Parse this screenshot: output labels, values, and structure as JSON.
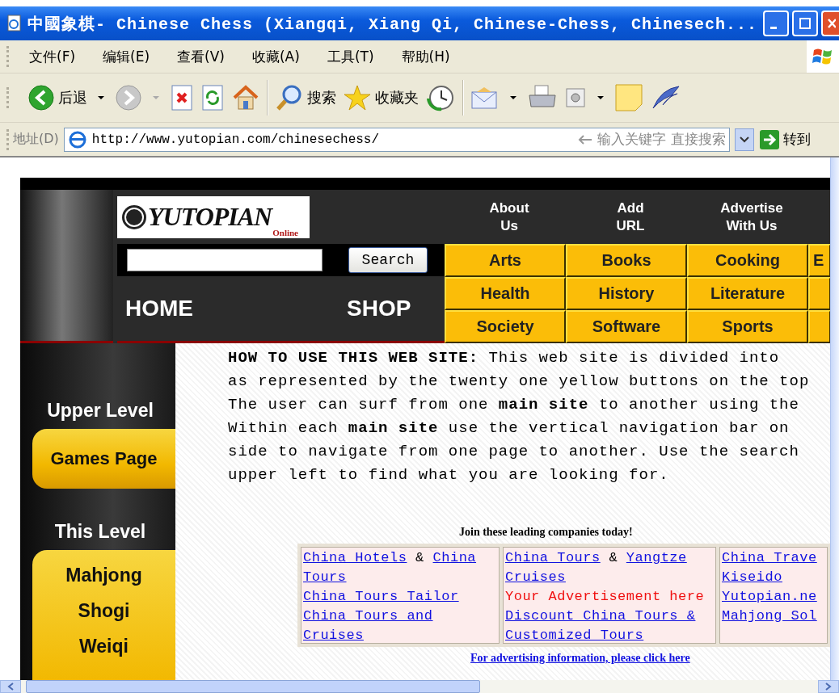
{
  "window": {
    "title": "中國象棋- Chinese Chess (Xiangqi, Xiang Qi, Chinese-Chess, Chinesech..."
  },
  "menu_bar": {
    "items": [
      "文件(F)",
      "编辑(E)",
      "查看(V)",
      "收藏(A)",
      "工具(T)",
      "帮助(H)"
    ]
  },
  "toolbar": {
    "back_label": "后退",
    "search_label": "搜索",
    "favorites_label": "收藏夹"
  },
  "address_bar": {
    "label": "地址(D)",
    "url": "http://www.yutopian.com/chinesechess/",
    "search_hint": "输入关键字 直接搜索",
    "go_label": "转到"
  },
  "site": {
    "logo": {
      "name": "YUTOPIAN",
      "tagline": "Online"
    },
    "top_links": [
      "About\nUs",
      "Add\nURL",
      "Advertise\nWith Us"
    ],
    "search": {
      "button": "Search"
    },
    "home_link": "HOME",
    "shop_link": "SHOP",
    "category_rows": [
      [
        "Arts",
        "Books",
        "Cooking",
        "E"
      ],
      [
        "Health",
        "History",
        "Literature"
      ],
      [
        "Society",
        "Software",
        "Sports"
      ]
    ],
    "sidebar": {
      "upper_heading": "Upper Level",
      "upper_items": [
        "Games Page"
      ],
      "this_heading": "This Level",
      "this_items": [
        "Mahjong",
        "Shogi",
        "Weiqi"
      ]
    },
    "intro": "**HOW TO USE THIS WEB SITE:** This web site is divided into\nas represented by the twenty one yellow buttons on the top\nThe user can surf from one **main site** to another using the\nWithin each **main site** use the vertical navigation bar on\nside to navigate from one page to another. Use the search\nupper left to find what you are looking for.",
    "ads": {
      "title": "Join these leading companies today!",
      "columns": [
        [
          [
            {
              "kind": "link",
              "text": "China Hotels"
            },
            {
              "kind": "plain",
              "text": " & "
            },
            {
              "kind": "link",
              "text": "China Tours"
            }
          ],
          [
            {
              "kind": "link",
              "text": "China Tours Tailor"
            }
          ],
          [
            {
              "kind": "link",
              "text": "China Tours and Cruises"
            }
          ]
        ],
        [
          [
            {
              "kind": "link",
              "text": "China Tours"
            },
            {
              "kind": "plain",
              "text": " & "
            },
            {
              "kind": "link",
              "text": "Yangtze Cruises"
            }
          ],
          [
            {
              "kind": "promo",
              "text": "Your Advertisement here"
            }
          ],
          [
            {
              "kind": "link",
              "text": "Discount China Tours & Customized Tours"
            }
          ]
        ],
        [
          [
            {
              "kind": "link",
              "text": "China Trave"
            }
          ],
          [
            {
              "kind": "link",
              "text": "Kiseido"
            }
          ],
          [
            {
              "kind": "link",
              "text": "Yutopian.ne"
            }
          ],
          [
            {
              "kind": "link",
              "text": "Mahjong Sol"
            }
          ]
        ]
      ],
      "footer_link": "For advertising information, please click here"
    }
  }
}
